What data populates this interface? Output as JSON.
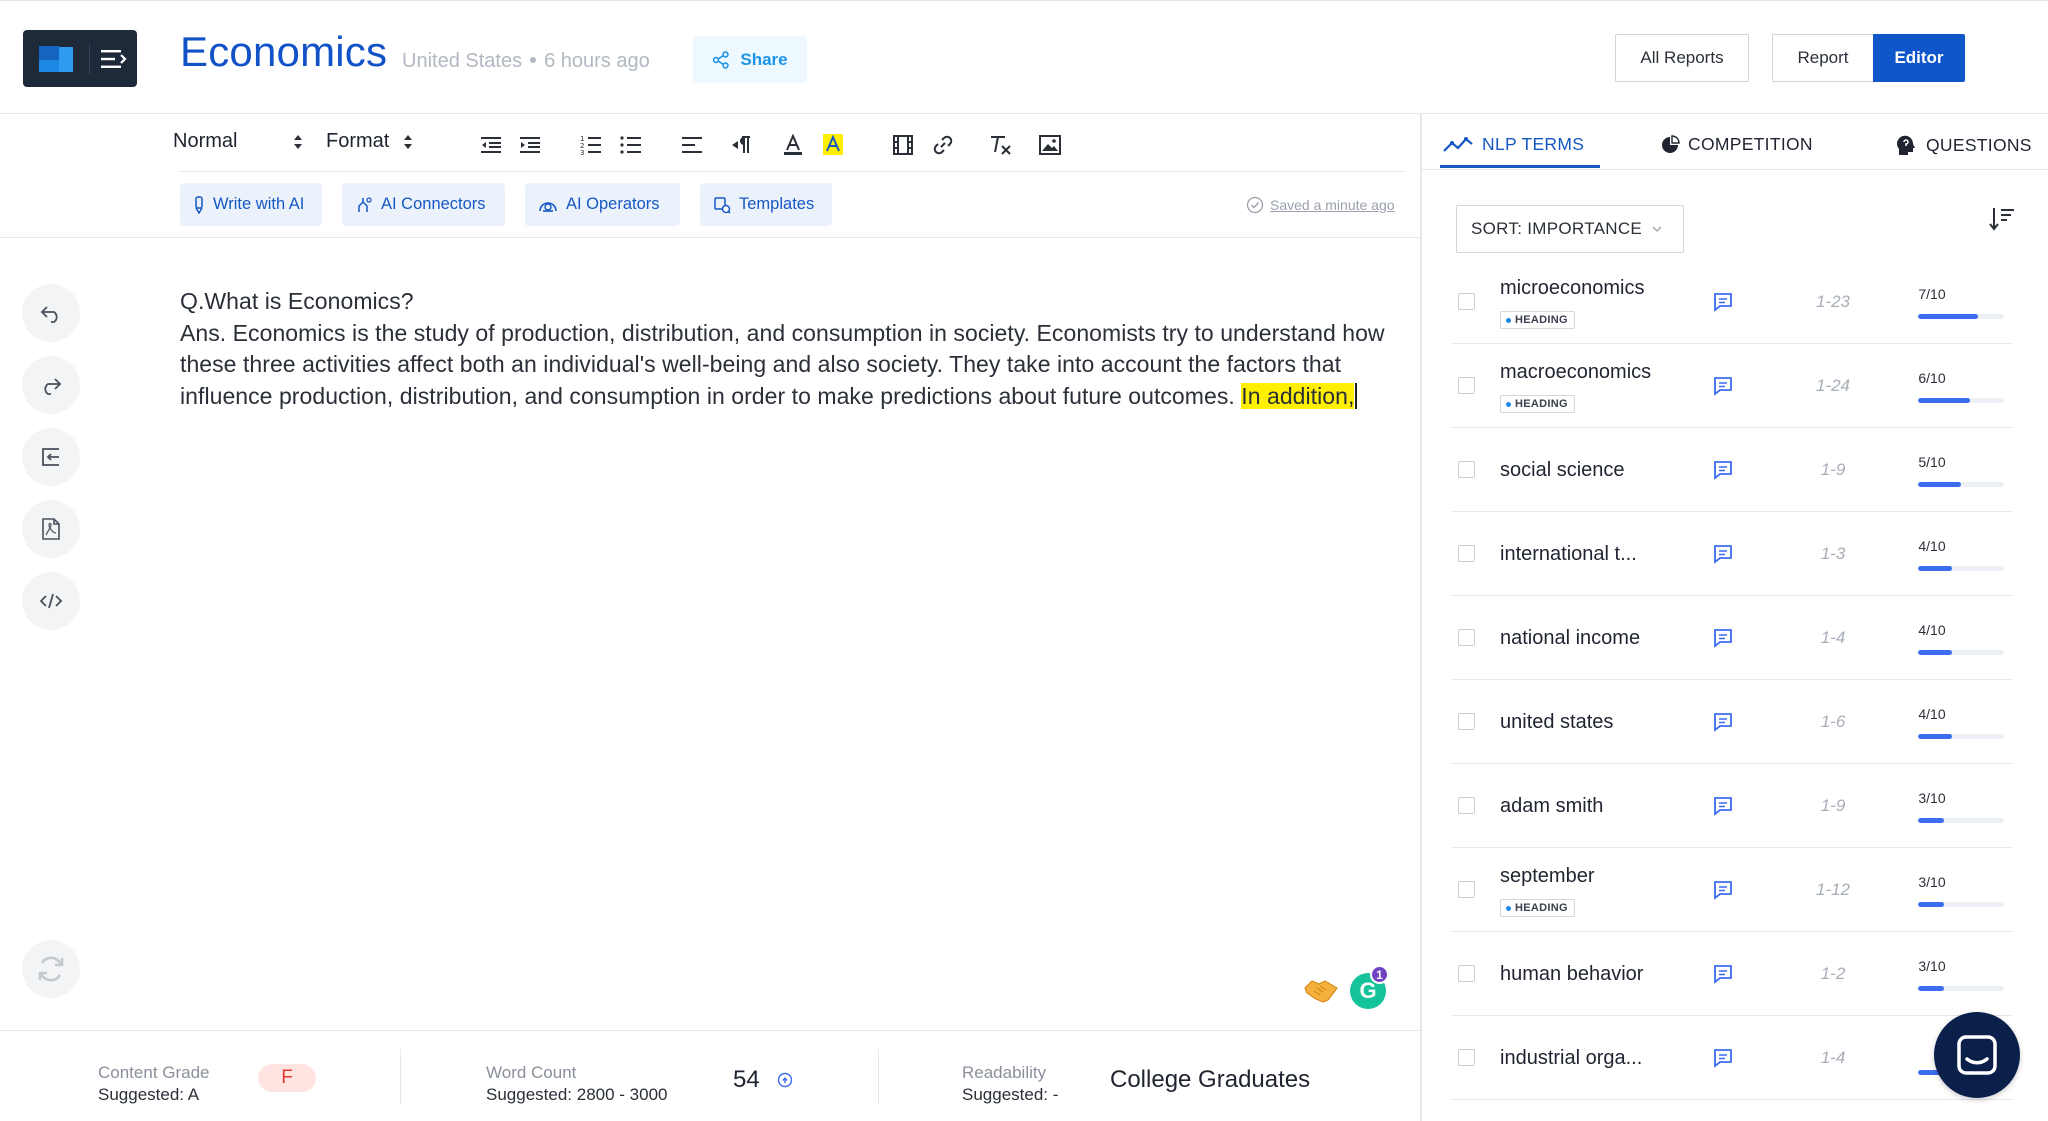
{
  "header": {
    "title": "Economics",
    "location": "United States",
    "updated": "6 hours ago",
    "share_label": "Share",
    "all_reports_label": "All Reports",
    "report_label": "Report",
    "editor_label": "Editor"
  },
  "toolbar": {
    "block_style": "Normal",
    "format": "Format"
  },
  "ai_bar": {
    "write_with_ai": "Write with AI",
    "ai_connectors": "AI Connectors",
    "ai_operators": "AI Operators",
    "templates": "Templates",
    "saved_status": "Saved a minute ago"
  },
  "editor": {
    "question": "Q.What is Economics?",
    "answer": "Ans. Economics is the study of production, distribution, and consumption in society. Economists try to understand how these three activities affect both an individual's well-being and also society. They take into account the factors that influence production, distribution, and consumption in order to make predictions about future outcomes. ",
    "highlighted": "In addition,"
  },
  "grammarly_count": "1",
  "footer": {
    "content_grade": {
      "label": "Content Grade",
      "suggested": "Suggested: A",
      "value": "F"
    },
    "word_count": {
      "label": "Word Count",
      "suggested": "Suggested: 2800 - 3000",
      "value": "54"
    },
    "readability": {
      "label": "Readability",
      "suggested": "Suggested: -",
      "value": "College Graduates"
    }
  },
  "panel": {
    "tabs": {
      "nlp_terms": "NLP TERMS",
      "competition": "COMPETITION",
      "questions": "QUESTIONS"
    },
    "sort_label": "SORT: IMPORTANCE",
    "terms": [
      {
        "name": "microeconomics",
        "tag": "HEADING",
        "range": "1-23",
        "score": "7/10",
        "level": 0.7
      },
      {
        "name": "macroeconomics",
        "tag": "HEADING",
        "range": "1-24",
        "score": "6/10",
        "level": 0.6
      },
      {
        "name": "social science",
        "tag": "",
        "range": "1-9",
        "score": "5/10",
        "level": 0.5
      },
      {
        "name": "international t...",
        "tag": "",
        "range": "1-3",
        "score": "4/10",
        "level": 0.4
      },
      {
        "name": "national income",
        "tag": "",
        "range": "1-4",
        "score": "4/10",
        "level": 0.4
      },
      {
        "name": "united states",
        "tag": "",
        "range": "1-6",
        "score": "4/10",
        "level": 0.4
      },
      {
        "name": "adam smith",
        "tag": "",
        "range": "1-9",
        "score": "3/10",
        "level": 0.3
      },
      {
        "name": "september",
        "tag": "HEADING",
        "range": "1-12",
        "score": "3/10",
        "level": 0.3
      },
      {
        "name": "human behavior",
        "tag": "",
        "range": "1-2",
        "score": "3/10",
        "level": 0.3
      },
      {
        "name": "industrial orga...",
        "tag": "",
        "range": "1-4",
        "score": "",
        "level": 0.3
      }
    ]
  },
  "colors": {
    "brand_blue": "#1252c8",
    "accent_blue": "#3c6df0",
    "highlight": "#ffef00",
    "grade_red": "#e53935"
  }
}
